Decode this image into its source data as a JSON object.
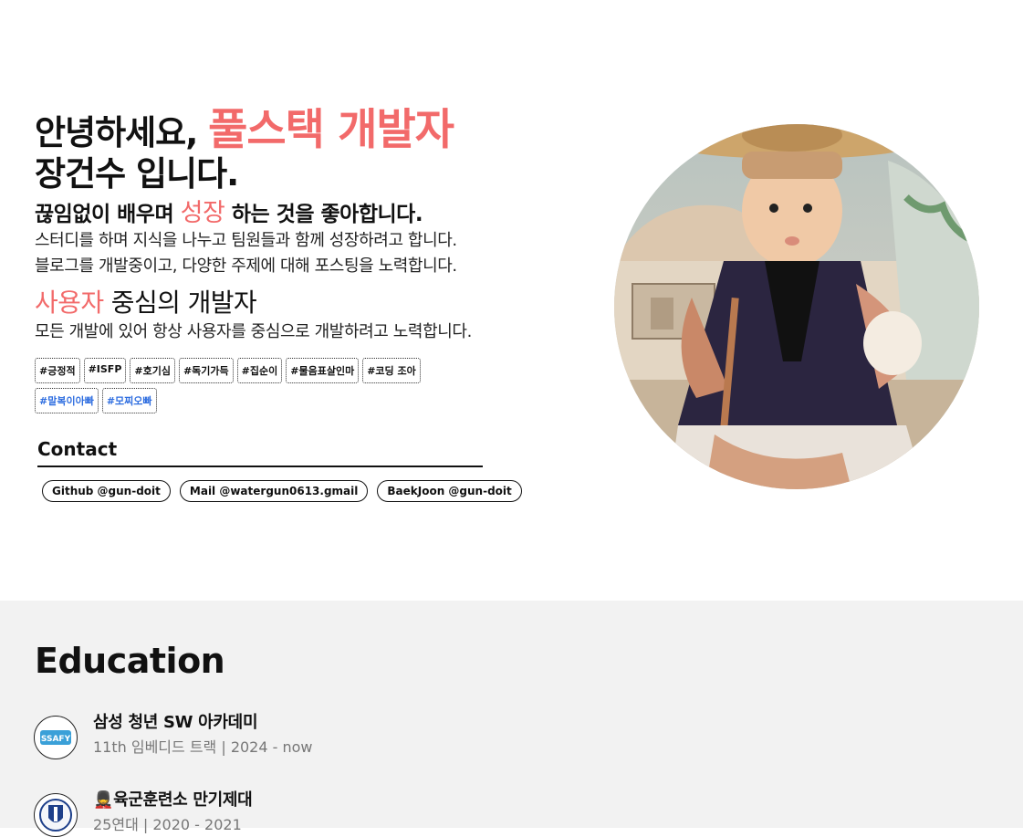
{
  "intro": {
    "greeting": "안녕하세요,",
    "role": "풀스택 개발자",
    "name": "장건수 입니다.",
    "growth": {
      "before": "끊임없이 배우며",
      "keyword": "성장",
      "after": "하는 것을 좋아합니다."
    },
    "growth_lines": [
      "스터디를 하며 지식을 나누고 팀원들과 함께 성장하려고 합니다.",
      "블로그를 개발중이고, 다양한 주제에 대해 포스팅을 노력합니다."
    ],
    "user": {
      "keyword": "사용자",
      "after": "중심의 개발자"
    },
    "user_line": "모든 개발에 있어 항상 사용자를 중심으로 개발하려고 노력합니다."
  },
  "tags": [
    "#긍정적",
    "#ISFP",
    "#호기심",
    "#독기가득",
    "#집순이",
    "#물음표살인마",
    "#코딩 조아",
    "#말복이아빠",
    "#모찌오빠"
  ],
  "contact": {
    "title": "Contact",
    "links": [
      "Github @gun-doit",
      "Mail @watergun0613.gmail",
      "BaekJoon @gun-doit"
    ]
  },
  "education": {
    "title": "Education",
    "items": [
      {
        "name": "삼성 청년 SW 아카데미",
        "detail": "11th 임베디드 트랙 | 2024 - now",
        "logo_text": "SSAFY"
      },
      {
        "name": "💂육군훈련소 만기제대",
        "detail": "25연대 | 2020 - 2021"
      }
    ]
  },
  "colors": {
    "accent": "#f26a6a",
    "tag_blue": "#2f6ee0",
    "section_bg": "#f2f2f2"
  }
}
